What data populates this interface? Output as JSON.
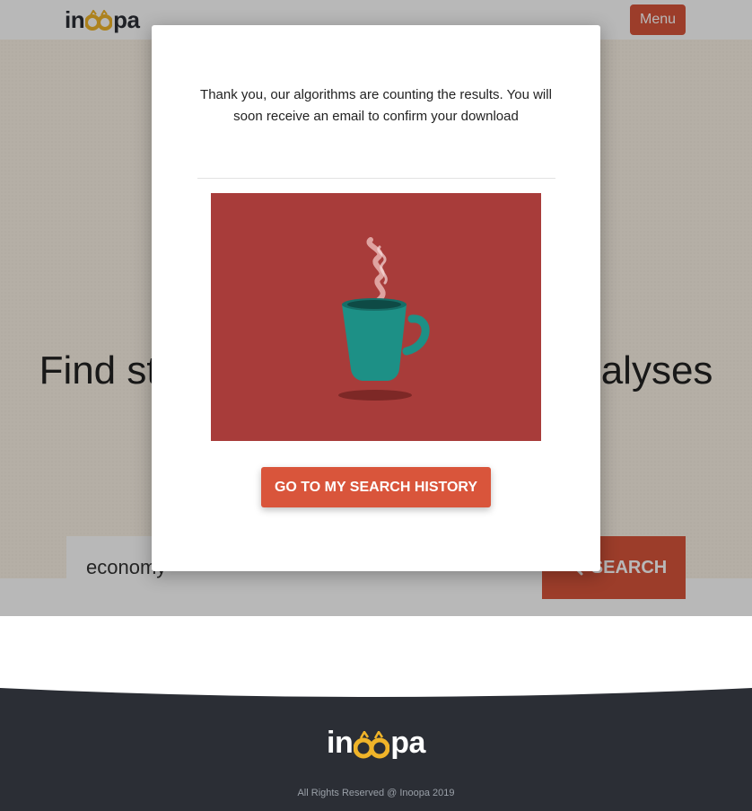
{
  "header": {
    "logo_prefix": "in",
    "logo_suffix": "pa",
    "menu_label": "Menu"
  },
  "hero": {
    "title": "Find studies, researches and analyses"
  },
  "search": {
    "value": "economy",
    "button_label": "SEARCH"
  },
  "modal": {
    "message": "Thank you, our algorithms are counting the results. You will soon receive an email to confirm your download",
    "cta_label": "GO TO MY SEARCH HISTORY"
  },
  "footer": {
    "logo_prefix": "in",
    "logo_suffix": "pa",
    "copyright": "All Rights Reserved @ Inoopa 2019"
  },
  "colors": {
    "accent": "#d9553b",
    "illustration_bg": "#a83c3a",
    "mug": "#1d9086",
    "footer_bg": "#2b2e35",
    "logo_owl": "#f0b429"
  },
  "icons": [
    "owl-logo-icon",
    "search-icon",
    "coffee-mug-icon"
  ]
}
